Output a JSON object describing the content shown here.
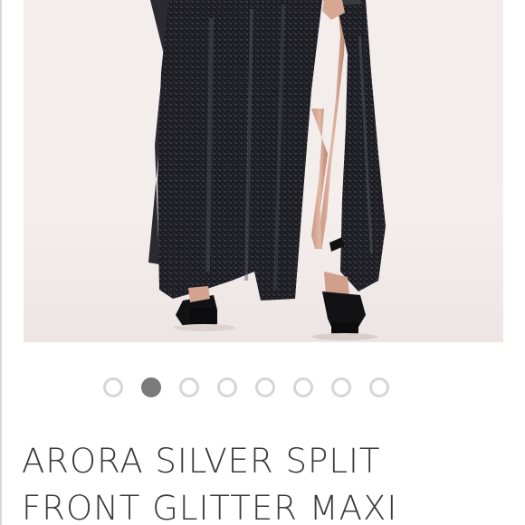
{
  "product": {
    "title": "ARORA SILVER SPLIT FRONT GLITTER MAXI",
    "image_alt": "Model wearing black glitter maxi skirt with front split and black platform sandals"
  },
  "carousel": {
    "total": 8,
    "active_index": 1
  },
  "colors": {
    "image_background": "#f2eceb",
    "dot_inactive": "#d6d6d6",
    "dot_active": "#7a7a7a",
    "title_text": "#3a3a3a"
  }
}
